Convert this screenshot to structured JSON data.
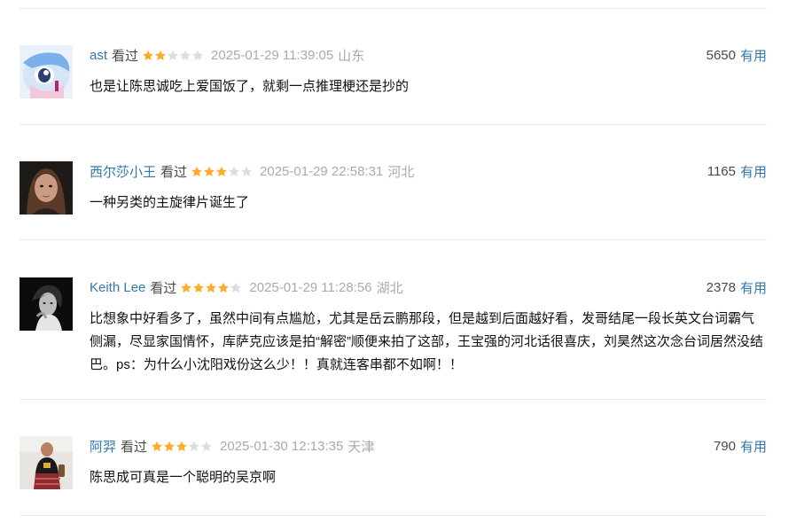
{
  "colors": {
    "link": "#3377aa",
    "star_filled": "#ffac2d",
    "star_empty": "#dddddd",
    "meta_gray": "#aaaaaa",
    "divider": "#eaeaea"
  },
  "comments": [
    {
      "user": "ast",
      "status": "看过",
      "rating": 2,
      "time": "2025-01-29 11:39:05",
      "location": "山东",
      "votes": "5650",
      "vote_label": "有用",
      "content": "也是让陈思诚吃上爱国饭了，就剩一点推理梗还是抄的",
      "avatar_icon": "anime-avatar-icon"
    },
    {
      "user": "西尔莎小王",
      "status": "看过",
      "rating": 3,
      "time": "2025-01-29 22:58:31",
      "location": "河北",
      "votes": "1165",
      "vote_label": "有用",
      "content": "一种另类的主旋律片诞生了",
      "avatar_icon": "portrait-avatar-icon"
    },
    {
      "user": "Keith Lee",
      "status": "看过",
      "rating": 4,
      "time": "2025-01-29 11:28:56",
      "location": "湖北",
      "votes": "2378",
      "vote_label": "有用",
      "content": "比想象中好看多了，虽然中间有点尴尬，尤其是岳云鹏那段，但是越到后面越好看，发哥结尾一段长英文台词霸气侧漏，尽显家国情怀，库萨克应该是拍“解密”顺便来拍了这部，王宝强的河北话很喜庆，刘昊然这次念台词居然没结巴。ps：为什么小沈阳戏份这么少！！真就连客串都不如啊！！",
      "avatar_icon": "bw-portrait-avatar-icon"
    },
    {
      "user": "阿羿",
      "status": "看过",
      "rating": 3,
      "time": "2025-01-30 12:13:35",
      "location": "天津",
      "votes": "790",
      "vote_label": "有用",
      "content": "陈思成可真是一个聪明的吴京啊",
      "avatar_icon": "photo-avatar-icon"
    }
  ]
}
